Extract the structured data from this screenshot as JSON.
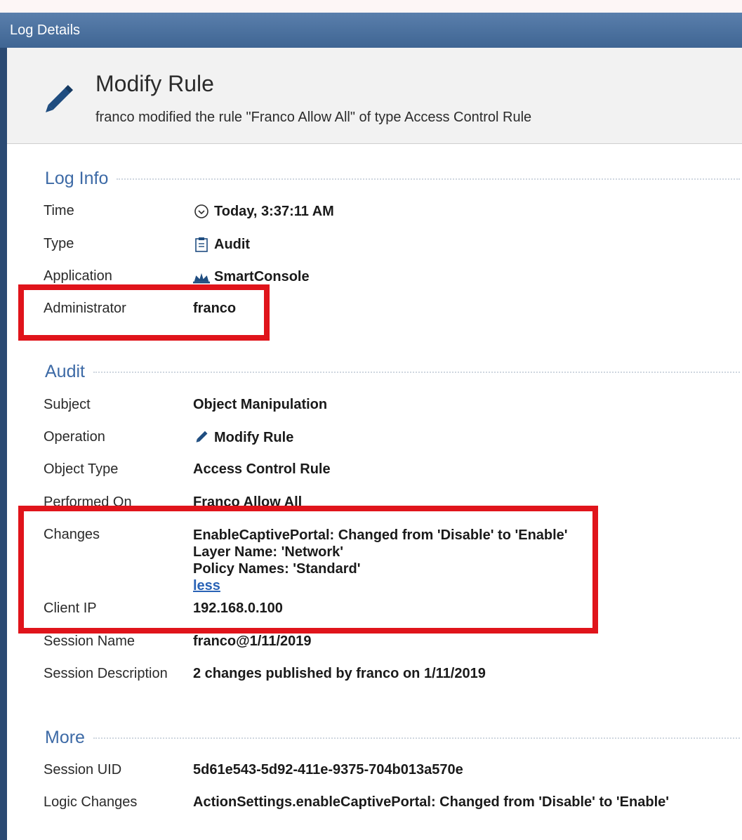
{
  "window": {
    "title": "Log Details"
  },
  "header": {
    "icon": "pencil-icon",
    "title": "Modify Rule",
    "description": "franco modified the rule \"Franco Allow All\" of type Access Control Rule"
  },
  "sections": {
    "log_info": {
      "title": "Log Info",
      "rows": [
        {
          "label": "Time",
          "value": "Today, 3:37:11 AM",
          "icon": "clock-icon"
        },
        {
          "label": "Type",
          "value": "Audit",
          "icon": "clipboard-icon"
        },
        {
          "label": "Application",
          "value": "SmartConsole",
          "icon": "crown-icon"
        },
        {
          "label": "Administrator",
          "value": "franco"
        }
      ]
    },
    "audit": {
      "title": "Audit",
      "rows": [
        {
          "label": "Subject",
          "value": "Object Manipulation"
        },
        {
          "label": "Operation",
          "value": "Modify Rule",
          "icon": "pencil-icon"
        },
        {
          "label": "Object Type",
          "value": "Access Control Rule"
        },
        {
          "label": "Performed On",
          "value": "Franco Allow All"
        },
        {
          "label": "Changes",
          "lines": [
            "EnableCaptivePortal: Changed from 'Disable' to 'Enable'",
            "Layer Name: 'Network'",
            "Policy Names: 'Standard'"
          ],
          "link": "less"
        },
        {
          "label": "Client IP",
          "value": "192.168.0.100"
        },
        {
          "label": "Session Name",
          "value": "franco@1/11/2019"
        },
        {
          "label": "Session Description",
          "value": "2 changes published by franco on 1/11/2019"
        }
      ]
    },
    "more": {
      "title": "More",
      "rows": [
        {
          "label": "Session UID",
          "value": "5d61e543-5d92-411e-9375-704b013a570e"
        },
        {
          "label": "Logic Changes",
          "value": "ActionSettings.enableCaptivePortal: Changed from 'Disable' to 'Enable'"
        }
      ]
    }
  },
  "colors": {
    "highlight": "#e0141b",
    "section_title": "#3d6aa6",
    "link": "#2a63b6",
    "titlebar": "#4a6f9c"
  }
}
